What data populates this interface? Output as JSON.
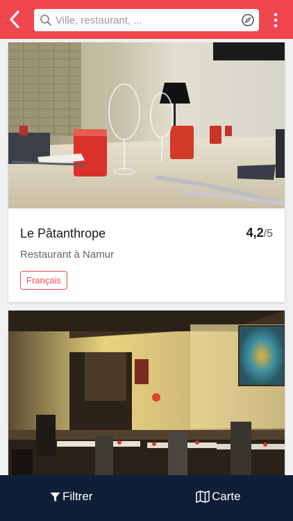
{
  "header": {
    "back_icon": "chevron-left-icon",
    "search": {
      "placeholder": "Ville, restaurant, ...",
      "icon": "search-icon",
      "locate_icon": "compass-icon"
    },
    "menu_icon": "more-vertical-icon",
    "color": "#f0474e"
  },
  "results": [
    {
      "name": "Le Pâtanthrope",
      "rating": {
        "score": "4,2",
        "max": "/5"
      },
      "subtitle": "Restaurant à Namur",
      "tags": [
        "Français"
      ]
    },
    {
      "name": "",
      "photo_only": true
    }
  ],
  "bottom_nav": {
    "filter_label": "Filtrer",
    "filter_icon": "filter-icon",
    "map_label": "Carte",
    "map_icon": "map-icon",
    "color": "#0f1f38"
  }
}
